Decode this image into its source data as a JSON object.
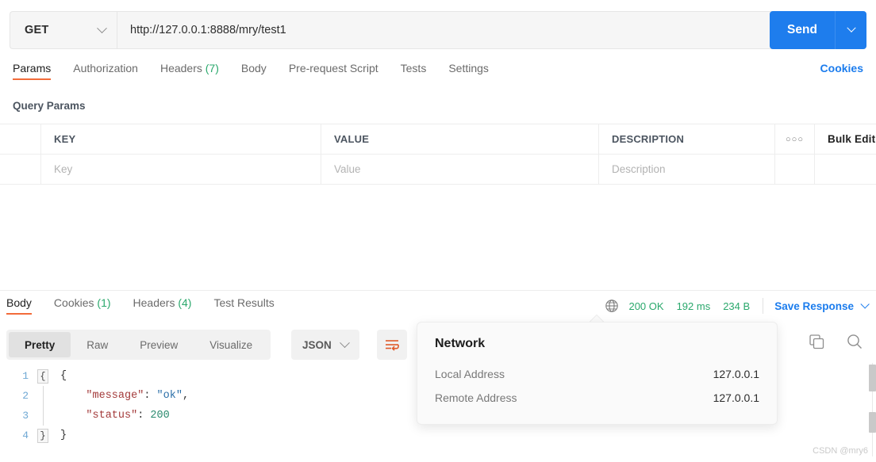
{
  "request": {
    "method": "GET",
    "url": "http://127.0.0.1:8888/mry/test1",
    "send_label": "Send",
    "tabs": [
      {
        "label": "Params",
        "count": "",
        "active": true
      },
      {
        "label": "Authorization",
        "count": "",
        "active": false
      },
      {
        "label": "Headers",
        "count": "(7)",
        "active": false
      },
      {
        "label": "Body",
        "count": "",
        "active": false
      },
      {
        "label": "Pre-request Script",
        "count": "",
        "active": false
      },
      {
        "label": "Tests",
        "count": "",
        "active": false
      },
      {
        "label": "Settings",
        "count": "",
        "active": false
      }
    ],
    "cookies_link": "Cookies"
  },
  "query_params": {
    "title": "Query Params",
    "columns": [
      "KEY",
      "VALUE",
      "DESCRIPTION"
    ],
    "options_glyph": "○○○",
    "bulk_edit": "Bulk Edit",
    "row_placeholders": [
      "Key",
      "Value",
      "Description"
    ]
  },
  "response": {
    "tabs": [
      {
        "label": "Body",
        "count": "",
        "active": true
      },
      {
        "label": "Cookies",
        "count": "(1)",
        "active": false
      },
      {
        "label": "Headers",
        "count": "(4)",
        "active": false
      },
      {
        "label": "Test Results",
        "count": "",
        "active": false
      }
    ],
    "status": "200 OK",
    "time": "192 ms",
    "size": "234 B",
    "save_response": "Save Response",
    "view_modes": [
      {
        "label": "Pretty",
        "active": true
      },
      {
        "label": "Raw",
        "active": false
      },
      {
        "label": "Preview",
        "active": false
      },
      {
        "label": "Visualize",
        "active": false
      }
    ],
    "format": "JSON",
    "body_lines": [
      {
        "no": "1",
        "segments": [
          {
            "t": "{",
            "c": "p"
          }
        ]
      },
      {
        "no": "2",
        "segments": [
          {
            "t": "    ",
            "c": "p"
          },
          {
            "t": "\"message\"",
            "c": "k"
          },
          {
            "t": ": ",
            "c": "p"
          },
          {
            "t": "\"ok\"",
            "c": "s"
          },
          {
            "t": ",",
            "c": "p"
          }
        ]
      },
      {
        "no": "3",
        "segments": [
          {
            "t": "    ",
            "c": "p"
          },
          {
            "t": "\"status\"",
            "c": "k"
          },
          {
            "t": ": ",
            "c": "p"
          },
          {
            "t": "200",
            "c": "n"
          }
        ]
      },
      {
        "no": "4",
        "segments": [
          {
            "t": "}",
            "c": "p"
          }
        ]
      }
    ]
  },
  "network_popover": {
    "title": "Network",
    "rows": [
      {
        "label": "Local Address",
        "value": "127.0.0.1"
      },
      {
        "label": "Remote Address",
        "value": "127.0.0.1"
      }
    ]
  },
  "watermark": "CSDN @mry6",
  "colors": {
    "accent_blue": "#1e7ded",
    "tab_underline": "#f26b3a",
    "status_green": "#2aa86c",
    "wrap_icon": "#e05a2b"
  }
}
